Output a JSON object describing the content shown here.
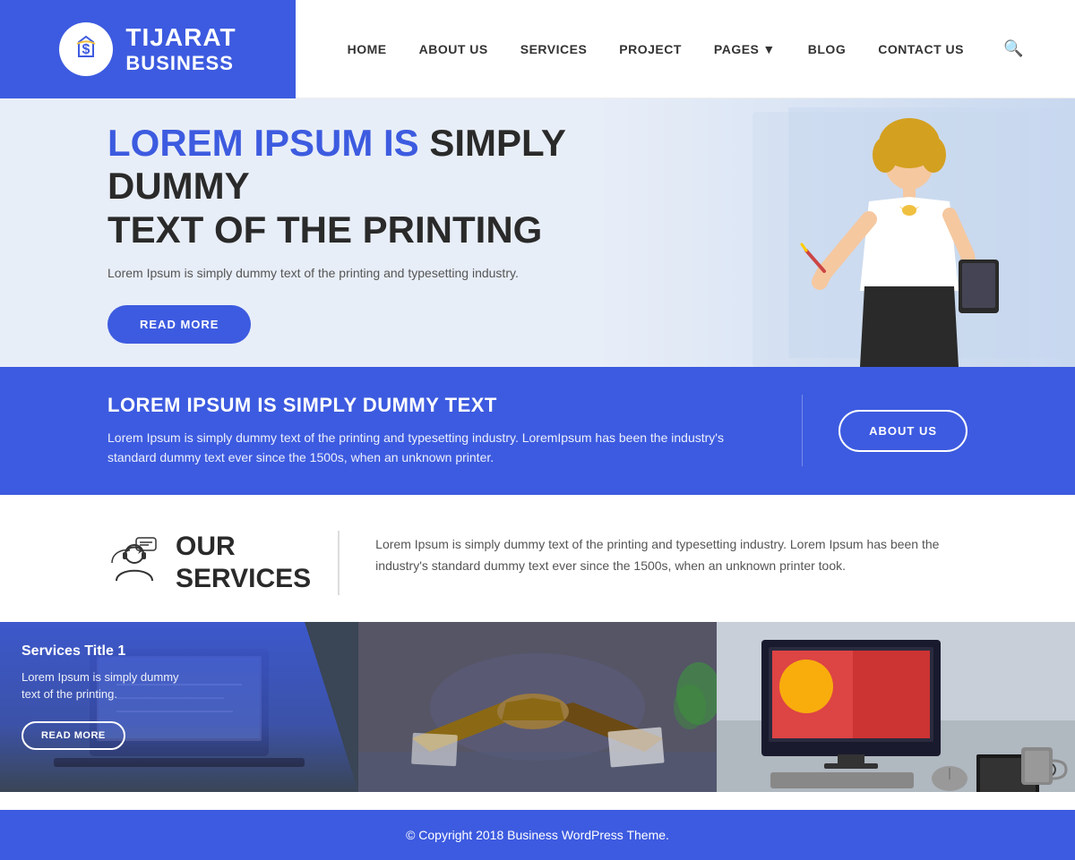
{
  "header": {
    "logo": {
      "line1": "TIJARAT",
      "line2": "BUSINESS"
    },
    "nav": {
      "items": [
        {
          "label": "HOME",
          "hasDropdown": false
        },
        {
          "label": "ABOUT US",
          "hasDropdown": false
        },
        {
          "label": "SERVICES",
          "hasDropdown": false
        },
        {
          "label": "PROJECT",
          "hasDropdown": false
        },
        {
          "label": "PAGES",
          "hasDropdown": true
        },
        {
          "label": "BLOG",
          "hasDropdown": false
        },
        {
          "label": "CONTACT US",
          "hasDropdown": false
        }
      ]
    }
  },
  "hero": {
    "title_accent": "LOREM IPSUM IS",
    "title_normal": " SIMPLY DUMMY TEXT OF THE PRINTING",
    "subtitle": "Lorem Ipsum is simply dummy text of the printing and typesetting industry.",
    "cta_label": "READ MORE"
  },
  "about_banner": {
    "title": "LOREM IPSUM IS SIMPLY DUMMY TEXT",
    "description": "Lorem Ipsum is simply dummy text of the printing and typesetting industry. LoremIpsum has been the industry's standard dummy text ever since the 1500s, when an unknown printer.",
    "button_label": "ABOUT US"
  },
  "services": {
    "heading": "OUR SERVICES",
    "description": "Lorem Ipsum is simply dummy text of the printing and typesetting industry. Lorem Ipsum has been the industry's standard dummy text ever since the 1500s, when an unknown printer took.",
    "cards": [
      {
        "title": "Services Title 1",
        "description": "Lorem Ipsum is simply dummy text of the printing.",
        "button_label": "READ MORE"
      },
      {
        "title": "",
        "description": "",
        "button_label": ""
      },
      {
        "title": "",
        "description": "",
        "button_label": ""
      }
    ]
  },
  "footer": {
    "copyright": "© Copyright 2018 Business WordPress Theme."
  }
}
